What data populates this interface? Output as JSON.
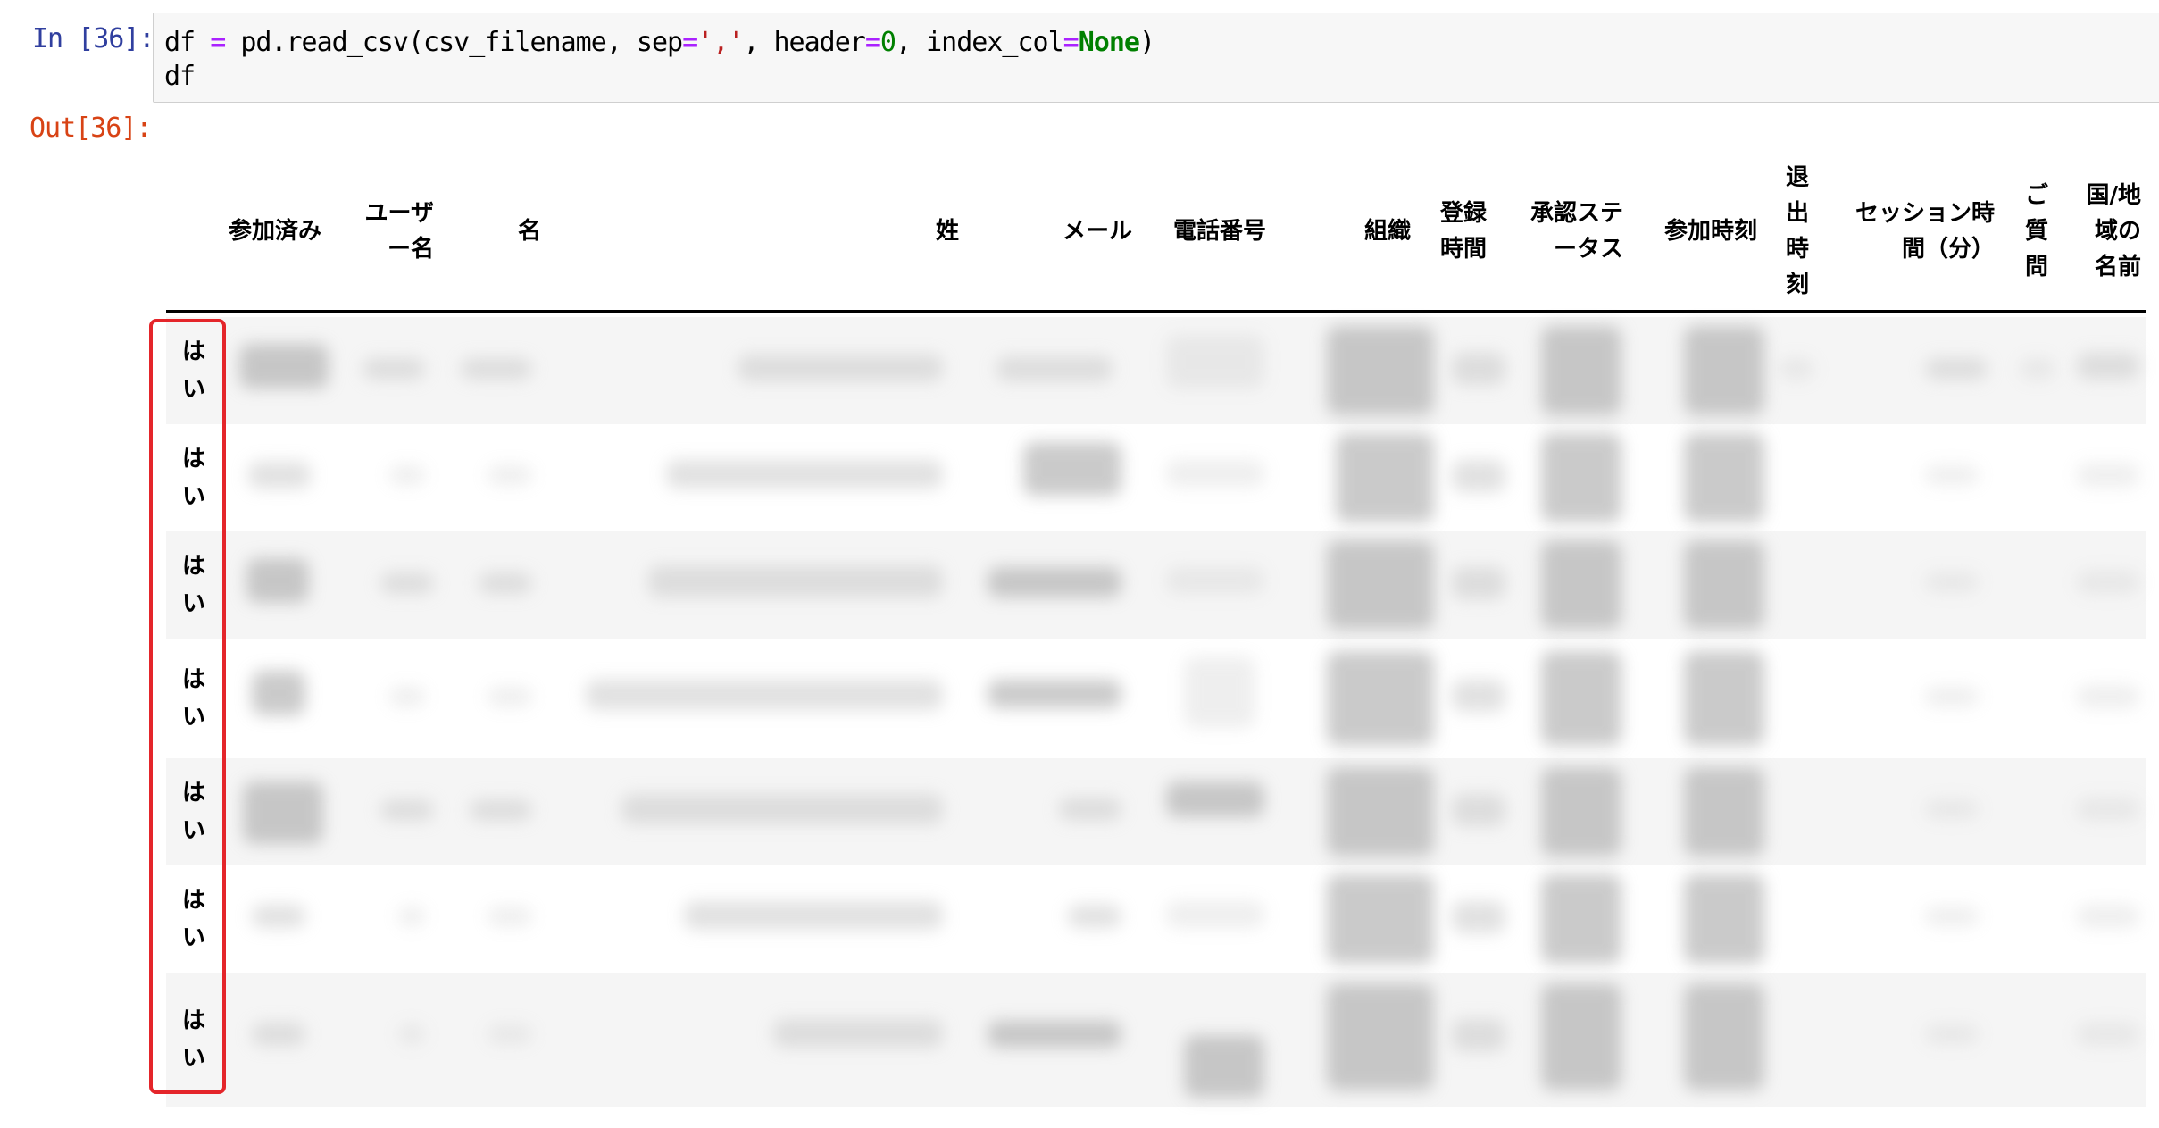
{
  "prompts": {
    "in": "In [36]:",
    "out": "Out[36]:"
  },
  "code": {
    "df": "df",
    "eq": "=",
    "call": "pd.read_csv(csv_filename,",
    "sep_key": "sep",
    "eq2": "=",
    "sep_val": "','",
    "comma1": ",",
    "header_key": "header",
    "eq3": "=",
    "header_val": "0",
    "comma2": ",",
    "index_key": "index_col",
    "eq4": "=",
    "index_val": "None",
    "close": ")",
    "line2": "df"
  },
  "table": {
    "columns": [
      "参加済み",
      "ユーザー名",
      "名",
      "姓",
      "メール",
      "電話番号",
      "組織",
      "登録時間",
      "承認ステータス",
      "参加時刻",
      "退出時刻",
      "セッション時間（分）",
      "ご質問",
      "国/地域の名前"
    ],
    "header_lines": {
      "c0": [
        "参加済み"
      ],
      "c1": [
        "ユーザ",
        "ー名"
      ],
      "c2": [
        "名"
      ],
      "c3": [
        "姓"
      ],
      "c4": [
        "メール"
      ],
      "c5": [
        "電話番号"
      ],
      "c6": [
        "組織"
      ],
      "c7": [
        "登録",
        "時間"
      ],
      "c8": [
        "承認ステ",
        "ータス"
      ],
      "c9": [
        "参加時刻"
      ],
      "c10": [
        "退",
        "出",
        "時",
        "刻"
      ],
      "c11": [
        "セッション時",
        "間（分）"
      ],
      "c12": [
        "ご",
        "質",
        "問"
      ],
      "c13": [
        "国/地",
        "域の",
        "名前"
      ]
    },
    "rows": [
      {
        "attended": [
          "は",
          "い"
        ]
      },
      {
        "attended": [
          "は",
          "い"
        ]
      },
      {
        "attended": [
          "は",
          "い"
        ]
      },
      {
        "attended": [
          "は",
          "い"
        ]
      },
      {
        "attended": [
          "は",
          "い"
        ]
      },
      {
        "attended": [
          "は",
          "い"
        ]
      },
      {
        "attended": [
          "は",
          "い"
        ]
      }
    ],
    "note": "All non-attended cells are blurred/redacted in the screenshot."
  },
  "colors": {
    "highlight": "#e4252a",
    "in_prompt": "#303f9f",
    "out_prompt": "#d84315"
  }
}
